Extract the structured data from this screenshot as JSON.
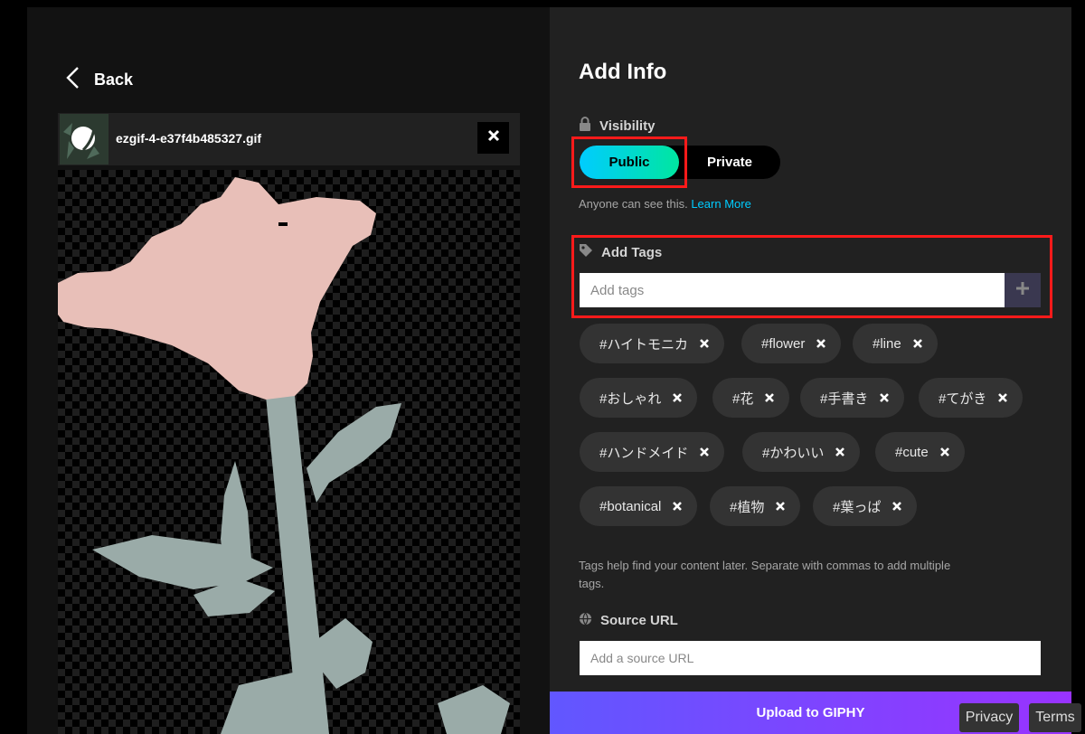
{
  "nav": {
    "back_label": "Back"
  },
  "file": {
    "name": "ezgif-4-e37f4b485327.gif"
  },
  "panel": {
    "title": "Add Info"
  },
  "visibility": {
    "label": "Visibility",
    "options": [
      "Public",
      "Private"
    ],
    "selected": "Public",
    "help_text": "Anyone can see this.",
    "learn_more": "Learn More"
  },
  "tags": {
    "label": "Add Tags",
    "placeholder": "Add tags",
    "items": [
      "#ハイトモニカ",
      "#flower",
      "#line",
      "#おしゃれ",
      "#花",
      "#手書き",
      "#てがき",
      "#ハンドメイド",
      "#かわいい",
      "#cute",
      "#botanical",
      "#植物",
      "#葉っぱ"
    ],
    "help_text": "Tags help find your content later. Separate with commas to add multiple tags."
  },
  "source": {
    "label": "Source URL",
    "placeholder": "Add a source URL"
  },
  "actions": {
    "upload_label": "Upload to GIPHY"
  },
  "footer": {
    "privacy": "Privacy",
    "terms": "Terms"
  },
  "colors": {
    "accent_cyan": "#00ccff",
    "accent_green": "#00e6a0",
    "upload_purple": "#9933ff",
    "highlight_red": "#ff1a1a",
    "flower_pink": "#e8bfb8",
    "leaf_gray": "#9aaba8"
  },
  "icons": {
    "back": "chevron-left-icon",
    "remove_file": "close-icon",
    "visibility": "lock-icon",
    "tags": "tag-icon",
    "add_tag": "plus-icon",
    "source": "globe-icon",
    "remove_tag": "close-icon"
  }
}
